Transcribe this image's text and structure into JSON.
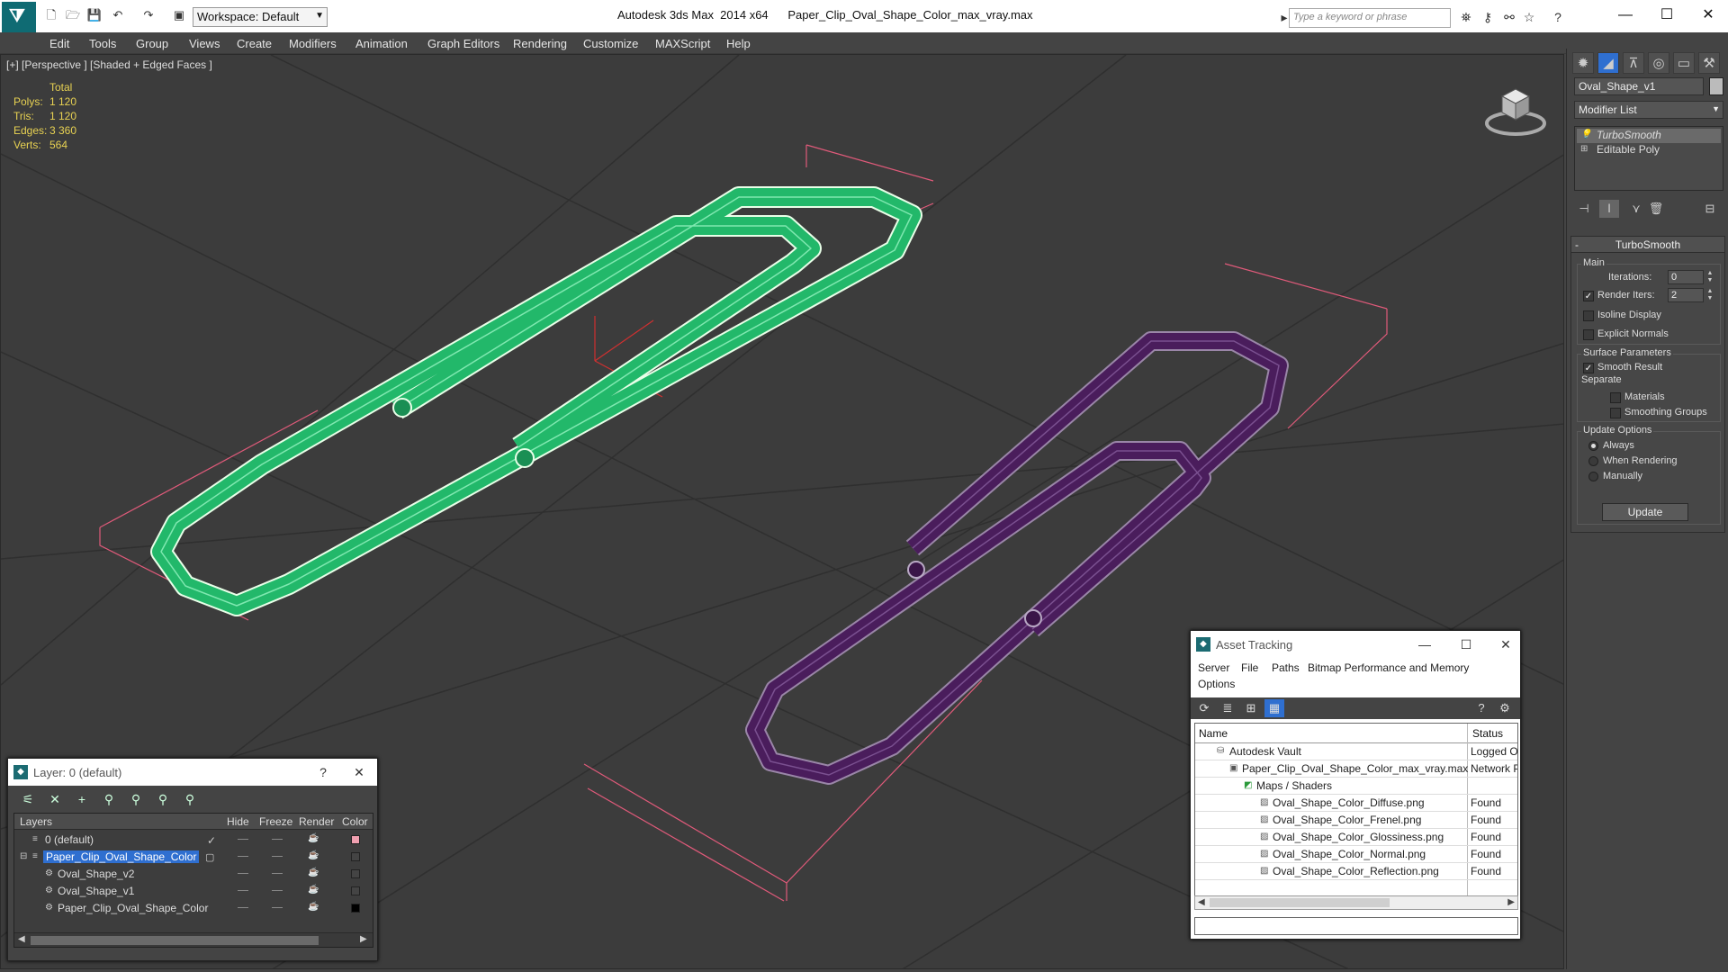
{
  "titlebar": {
    "workspace": "Workspace: Default",
    "app_title": "Autodesk 3ds Max  2014 x64      Paper_Clip_Oval_Shape_Color_max_vray.max",
    "search_placeholder": "Type a keyword or phrase"
  },
  "menu": [
    "Edit",
    "Tools",
    "Group",
    "Views",
    "Create",
    "Modifiers",
    "Animation",
    "Graph Editors",
    "Rendering",
    "Customize",
    "MAXScript",
    "Help"
  ],
  "viewport": {
    "label": "[+] [Perspective ] [Shaded + Edged Faces ]",
    "stats": {
      "header": "Total",
      "rows": [
        {
          "k": "Polys:",
          "v": "1 120"
        },
        {
          "k": "Tris:",
          "v": "1 120"
        },
        {
          "k": "Edges:",
          "v": "3 360"
        },
        {
          "k": "Verts:",
          "v": "564"
        }
      ]
    },
    "colors": {
      "green": "#22b86a",
      "purple": "#4a1d5c",
      "bbox": "#e05a7a"
    }
  },
  "command_panel": {
    "object_name": "Oval_Shape_v1",
    "modifier_list": "Modifier List",
    "stack": [
      "TurboSmooth",
      "Editable Poly"
    ],
    "rollout_title": "TurboSmooth",
    "main_group": "Main",
    "iterations_label": "Iterations:",
    "iterations_value": "0",
    "render_iters_label": "Render Iters:",
    "render_iters_value": "2",
    "isoline": "Isoline Display",
    "explicit_normals": "Explicit Normals",
    "surface_group": "Surface Parameters",
    "smooth_result": "Smooth Result",
    "separate": "Separate",
    "materials": "Materials",
    "smoothing_groups": "Smoothing Groups",
    "update_group": "Update Options",
    "always": "Always",
    "when_rendering": "When Rendering",
    "manually": "Manually",
    "update_btn": "Update"
  },
  "layer_panel": {
    "title": "Layer: 0 (default)",
    "help": "?",
    "columns": [
      "Layers",
      "Hide",
      "Freeze",
      "Render",
      "Color"
    ],
    "rows": [
      {
        "name": "0 (default)",
        "color": "#f0a0b0"
      },
      {
        "name": "Paper_Clip_Oval_Shape_Color",
        "color": "#444444"
      },
      {
        "name": "Oval_Shape_v2",
        "color": "#444444"
      },
      {
        "name": "Oval_Shape_v1",
        "color": "#444444"
      },
      {
        "name": "Paper_Clip_Oval_Shape_Color",
        "color": "#000000"
      }
    ]
  },
  "asset_panel": {
    "title": "Asset Tracking",
    "menu": [
      "Server",
      "File",
      "Paths",
      "Bitmap Performance and Memory",
      "Options"
    ],
    "columns": [
      "Name",
      "Status"
    ],
    "rows": [
      {
        "name": "Autodesk Vault",
        "status": "Logged Ou"
      },
      {
        "name": "Paper_Clip_Oval_Shape_Color_max_vray.max",
        "status": "Network P"
      },
      {
        "name": "Maps / Shaders",
        "status": ""
      },
      {
        "name": "Oval_Shape_Color_Diffuse.png",
        "status": "Found"
      },
      {
        "name": "Oval_Shape_Color_Frenel.png",
        "status": "Found"
      },
      {
        "name": "Oval_Shape_Color_Glossiness.png",
        "status": "Found"
      },
      {
        "name": "Oval_Shape_Color_Normal.png",
        "status": "Found"
      },
      {
        "name": "Oval_Shape_Color_Reflection.png",
        "status": "Found"
      }
    ]
  }
}
